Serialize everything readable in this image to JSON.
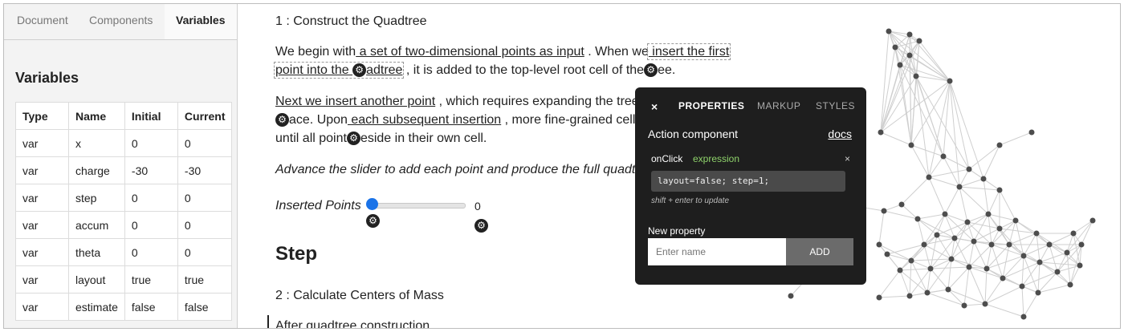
{
  "sidebar": {
    "tabs": [
      {
        "label": "Document"
      },
      {
        "label": "Components"
      },
      {
        "label": "Variables"
      }
    ],
    "title": "Variables",
    "columns": [
      "Type",
      "Name",
      "Initial",
      "Current"
    ],
    "rows": [
      [
        "var",
        "x",
        "0",
        "0"
      ],
      [
        "var",
        "charge",
        "-30",
        "-30"
      ],
      [
        "var",
        "step",
        "0",
        "0"
      ],
      [
        "var",
        "accum",
        "0",
        "0"
      ],
      [
        "var",
        "theta",
        "0",
        "0"
      ],
      [
        "var",
        "layout",
        "true",
        "true"
      ],
      [
        "var",
        "estimate",
        "false",
        "false"
      ]
    ]
  },
  "main": {
    "heading1": "1 : Construct the Quadtree",
    "para1": {
      "a": "We begin with",
      "b": " a set of two-dimensional points as input",
      "c": " . When we",
      "d": " insert the first",
      "e": "point into the ",
      "f": "adtree",
      "g": " , it is added to the top-level root cell of the",
      "h": "ee."
    },
    "para2": {
      "a": "Next we insert another point",
      "b": " , which requires expanding the tree",
      "c": "ace. Upon",
      "d": " each subsequent insertion",
      "e": " , more fine-grained cells",
      "f": "until all point",
      "g": "eside in their own cell."
    },
    "para3": "Advance the slider to add each point and produce the full quadtr",
    "slider_label": "Inserted Points",
    "slider_value": "0",
    "slider_level": 0,
    "step_heading": "Step",
    "heading2": "2 : Calculate Centers of Mass",
    "para4": "After quadtree construction"
  },
  "panel": {
    "close": "×",
    "tabs": [
      "PROPERTIES",
      "MARKUP",
      "STYLES"
    ],
    "component_title": "Action component",
    "docs": "docs",
    "prop_name": "onClick",
    "prop_type": "expression",
    "prop_remove": "×",
    "code": "layout=false; step=1;",
    "hint": "shift + enter to update",
    "new_property_label": "New property",
    "new_property_placeholder": "Enter name",
    "add_label": "ADD"
  },
  "icons": {
    "gear": "gear-icon"
  },
  "colors": {
    "slider_thumb": "#1a73e8",
    "panel_bg": "#1e1e1e",
    "expression": "#8fd36b"
  }
}
